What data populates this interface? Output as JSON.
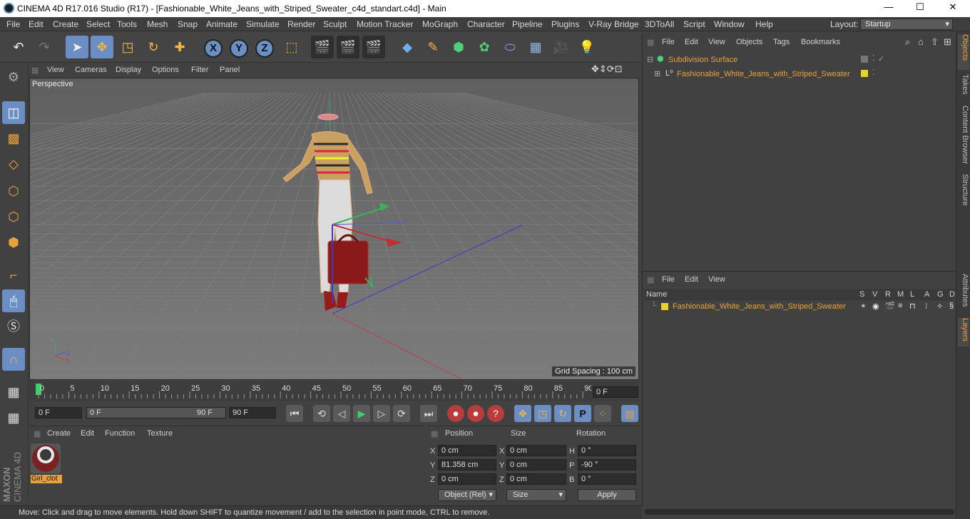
{
  "titlebar": {
    "title": "CINEMA 4D R17.016 Studio (R17) - [Fashionable_White_Jeans_with_Striped_Sweater_c4d_standart.c4d] - Main",
    "min": "—",
    "max": "☐",
    "close": "✕"
  },
  "menu": [
    "File",
    "Edit",
    "Create",
    "Select",
    "Tools",
    "Mesh",
    "Snap",
    "Animate",
    "Simulate",
    "Render",
    "Sculpt",
    "Motion Tracker",
    "MoGraph",
    "Character",
    "Pipeline",
    "Plugins",
    "V-Ray Bridge",
    "3DToAll",
    "Script",
    "Window",
    "Help"
  ],
  "layout": {
    "label": "Layout:",
    "value": "Startup"
  },
  "toolbar": {
    "icons": [
      "undo-icon",
      "redo-icon",
      "select-cursor-icon",
      "move-icon",
      "scale-icon",
      "rotate-icon",
      "add-icon",
      "x-axis-icon",
      "y-axis-icon",
      "z-axis-icon",
      "coordinate-system-icon",
      "render-view-icon",
      "render-picture-viewer-icon",
      "render-settings-icon",
      "cube-icon",
      "pen-icon",
      "subdivision-icon",
      "cloner-icon",
      "deformer-icon",
      "floor-icon",
      "camera-icon",
      "light-icon"
    ],
    "axis_x": "X",
    "axis_y": "Y",
    "axis_z": "Z"
  },
  "viewport": {
    "menu": [
      "View",
      "Cameras",
      "Display",
      "Options",
      "Filter",
      "Panel"
    ],
    "label": "Perspective",
    "grid_spacing": "Grid Spacing : 100 cm"
  },
  "timeline": {
    "ticks": [
      "0",
      "5",
      "10",
      "15",
      "20",
      "25",
      "30",
      "35",
      "40",
      "45",
      "50",
      "55",
      "60",
      "65",
      "70",
      "75",
      "80",
      "85",
      "90"
    ],
    "current_frame": "0 F",
    "start": "0 F",
    "range_left": "0 F",
    "range_right": "90 F",
    "end": "90 F"
  },
  "material": {
    "menu": [
      "Create",
      "Edit",
      "Function",
      "Texture"
    ],
    "name": "Girl_clot"
  },
  "coords": {
    "headers": [
      "Position",
      "Size",
      "Rotation"
    ],
    "rows": [
      {
        "a": "X",
        "pos": "0 cm",
        "b": "X",
        "size": "0 cm",
        "c": "H",
        "rot": "0 °"
      },
      {
        "a": "Y",
        "pos": "81.358 cm",
        "b": "Y",
        "size": "0 cm",
        "c": "P",
        "rot": "-90 °"
      },
      {
        "a": "Z",
        "pos": "0 cm",
        "b": "Z",
        "size": "0 cm",
        "c": "B",
        "rot": "0 °"
      }
    ],
    "mode": "Object (Rel)",
    "size_mode": "Size",
    "apply": "Apply"
  },
  "status": "Move: Click and drag to move elements. Hold down SHIFT to quantize movement / add to the selection in point mode, CTRL to remove.",
  "objects": {
    "menu": [
      "File",
      "Edit",
      "View",
      "Objects",
      "Tags",
      "Bookmarks"
    ],
    "items": [
      "Subdivision Surface",
      "Fashionable_White_Jeans_with_Striped_Sweater"
    ]
  },
  "layers": {
    "menu": [
      "File",
      "Edit",
      "View"
    ],
    "col_name": "Name",
    "cols": [
      "S",
      "V",
      "R",
      "M",
      "L",
      "A",
      "G",
      "D"
    ],
    "item": "Fashionable_White_Jeans_with_Striped_Sweater"
  },
  "right_tabs": [
    "Objects",
    "Takes",
    "Content Browser",
    "Structure",
    "Attributes",
    "Layers"
  ],
  "brand": {
    "maxon": "MAXON",
    "product": "CINEMA 4D"
  },
  "colors": {
    "accent": "#e9a13c",
    "selected": "#6b8ec4",
    "layer": "#e8d12a"
  }
}
